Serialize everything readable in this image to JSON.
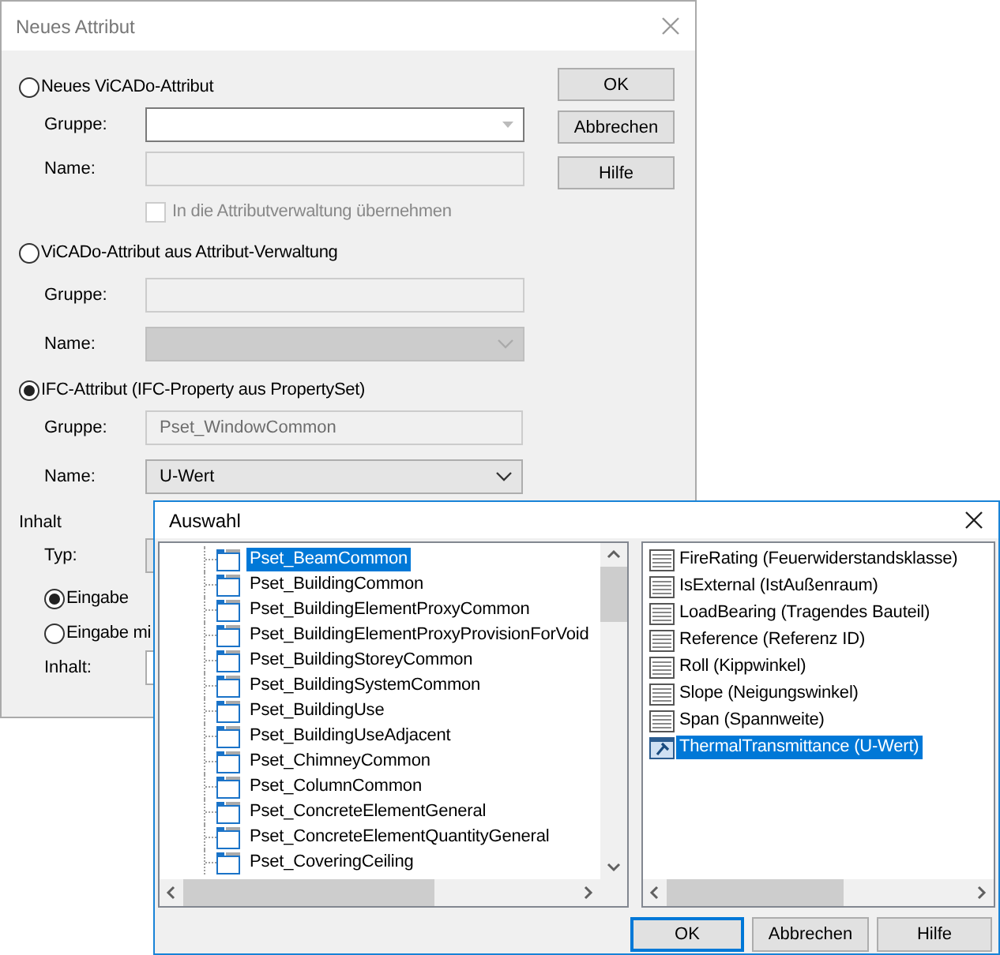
{
  "main_dialog": {
    "title": "Neues Attribut",
    "sections": [
      {
        "label": "Neues ViCADo-Attribut",
        "selected": false,
        "fields": [
          {
            "label": "Gruppe:",
            "kind": "combo",
            "disabled": false
          },
          {
            "label": "Name:",
            "kind": "text",
            "disabled": true
          }
        ],
        "checkbox": {
          "label": "In die Attributverwaltung übernehmen",
          "checked": false,
          "disabled": true
        }
      },
      {
        "label": "ViCADo-Attribut aus Attribut-Verwaltung",
        "selected": false,
        "fields": [
          {
            "label": "Gruppe:",
            "kind": "text",
            "disabled": true
          },
          {
            "label": "Name:",
            "kind": "dropdown",
            "disabled": true
          }
        ]
      },
      {
        "label": "IFC-Attribut (IFC-Property aus PropertySet)",
        "selected": true,
        "fields": [
          {
            "label": "Gruppe:",
            "kind": "text",
            "disabled": true,
            "value": "Pset_WindowCommon"
          },
          {
            "label": "Name:",
            "kind": "dropdown",
            "disabled": false,
            "value": "U-Wert"
          }
        ]
      }
    ],
    "content": {
      "label": "Inhalt",
      "type_label": "Typ:",
      "modes": [
        {
          "label": "Eingabe",
          "selected": true
        },
        {
          "label": "Eingabe mi",
          "selected": false
        }
      ],
      "content_label": "Inhalt:"
    },
    "buttons": [
      "OK",
      "Abbrechen",
      "Hilfe"
    ]
  },
  "selection_dialog": {
    "title": "Auswahl",
    "tree": [
      {
        "label": "Pset_BeamCommon",
        "selected": true
      },
      {
        "label": "Pset_BuildingCommon",
        "selected": false
      },
      {
        "label": "Pset_BuildingElementProxyCommon",
        "selected": false
      },
      {
        "label": "Pset_BuildingElementProxyProvisionForVoid",
        "selected": false
      },
      {
        "label": "Pset_BuildingStoreyCommon",
        "selected": false
      },
      {
        "label": "Pset_BuildingSystemCommon",
        "selected": false
      },
      {
        "label": "Pset_BuildingUse",
        "selected": false
      },
      {
        "label": "Pset_BuildingUseAdjacent",
        "selected": false
      },
      {
        "label": "Pset_ChimneyCommon",
        "selected": false
      },
      {
        "label": "Pset_ColumnCommon",
        "selected": false
      },
      {
        "label": "Pset_ConcreteElementGeneral",
        "selected": false
      },
      {
        "label": "Pset_ConcreteElementQuantityGeneral",
        "selected": false
      },
      {
        "label": "Pset_CoveringCeiling",
        "selected": false
      }
    ],
    "properties": [
      {
        "label": "FireRating (Feuerwiderstandsklasse)",
        "selected": false
      },
      {
        "label": "IsExternal (IstAußenraum)",
        "selected": false
      },
      {
        "label": "LoadBearing (Tragendes Bauteil)",
        "selected": false
      },
      {
        "label": "Reference (Referenz ID)",
        "selected": false
      },
      {
        "label": "Roll (Kippwinkel)",
        "selected": false
      },
      {
        "label": "Slope (Neigungswinkel)",
        "selected": false
      },
      {
        "label": "Span (Spannweite)",
        "selected": false
      },
      {
        "label": "ThermalTransmittance (U-Wert)",
        "selected": true
      }
    ],
    "buttons": [
      {
        "label": "OK",
        "focused": true
      },
      {
        "label": "Abbrechen",
        "focused": false
      },
      {
        "label": "Hilfe",
        "focused": false
      }
    ]
  }
}
